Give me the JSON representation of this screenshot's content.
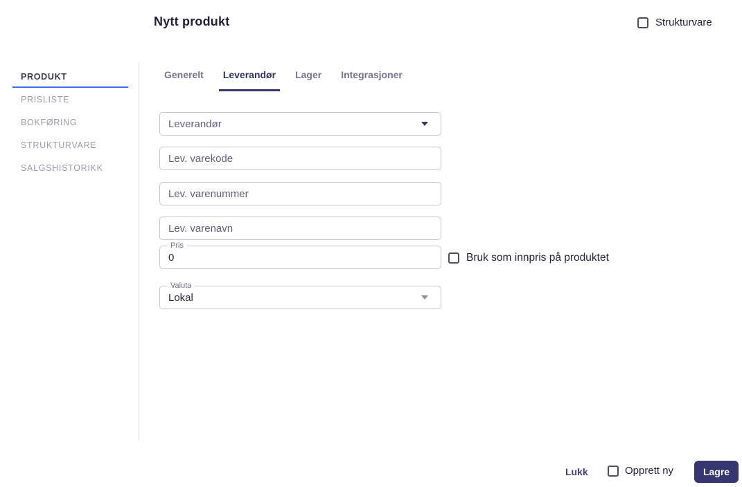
{
  "header": {
    "title": "Nytt produkt",
    "strukturvare_checkbox": {
      "label": "Strukturvare",
      "checked": false
    }
  },
  "sidebar": {
    "items": [
      {
        "label": "PRODUKT",
        "active": true
      },
      {
        "label": "PRISLISTE",
        "active": false
      },
      {
        "label": "BOKFØRING",
        "active": false
      },
      {
        "label": "STRUKTURVARE",
        "active": false
      },
      {
        "label": "SALGSHISTORIKK",
        "active": false
      }
    ]
  },
  "tabs": [
    {
      "label": "Generelt",
      "active": false
    },
    {
      "label": "Leverandør",
      "active": true
    },
    {
      "label": "Lager",
      "active": false
    },
    {
      "label": "Integrasjoner",
      "active": false
    }
  ],
  "form": {
    "leverandor_select": {
      "value": "Leverandør"
    },
    "varekode_input": {
      "placeholder": "Lev. varekode",
      "value": ""
    },
    "varenummer_input": {
      "placeholder": "Lev. varenummer",
      "value": ""
    },
    "varenavn_input": {
      "placeholder": "Lev. varenavn",
      "value": ""
    },
    "pris_field": {
      "label": "Pris",
      "value": "0"
    },
    "valuta_select": {
      "label": "Valuta",
      "value": "Lokal"
    },
    "innpris_checkbox": {
      "label": "Bruk som innpris på produktet",
      "checked": false
    }
  },
  "footer": {
    "lukk_label": "Lukk",
    "opprett_ny_checkbox": {
      "label": "Opprett ny",
      "checked": false
    },
    "lagre_label": "Lagre"
  },
  "colors": {
    "accent_blue": "#3e6bf2",
    "active_navy": "#36366b",
    "button_bg": "#363670",
    "muted_text": "#5f5f7d",
    "sidebar_inactive": "#9b9ba6",
    "border": "#c6c6ce"
  }
}
